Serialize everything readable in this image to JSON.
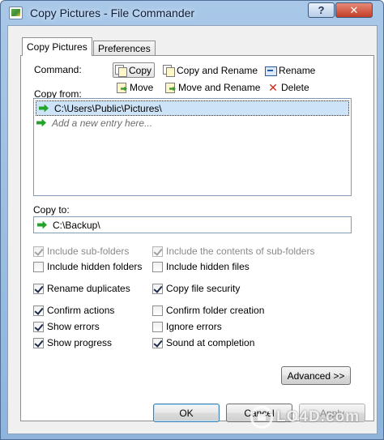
{
  "window": {
    "title": "Copy Pictures - File Commander",
    "help_label": "?",
    "close_label": "✕"
  },
  "tabs": [
    "Copy Pictures",
    "Preferences"
  ],
  "command": {
    "label": "Command:",
    "buttons": [
      "Copy",
      "Copy and Rename",
      "Rename",
      "Move",
      "Move and Rename",
      "Delete"
    ],
    "selected": "Copy"
  },
  "copy_from": {
    "label": "Copy from:",
    "entries": [
      "C:\\Users\\Public\\Pictures\\"
    ],
    "add_placeholder": "Add a new entry here..."
  },
  "copy_to": {
    "label": "Copy to:",
    "value": "C:\\Backup\\"
  },
  "options": {
    "include_subfolders": {
      "label": "Include sub-folders",
      "checked": true,
      "enabled": false
    },
    "include_contents_subfolders": {
      "label": "Include the contents of sub-folders",
      "checked": true,
      "enabled": false
    },
    "include_hidden_folders": {
      "label": "Include hidden folders",
      "checked": false,
      "enabled": true
    },
    "include_hidden_files": {
      "label": "Include hidden files",
      "checked": false,
      "enabled": true
    },
    "rename_duplicates": {
      "label": "Rename duplicates",
      "checked": true,
      "enabled": true
    },
    "copy_file_security": {
      "label": "Copy file security",
      "checked": true,
      "enabled": true
    },
    "confirm_actions": {
      "label": "Confirm actions",
      "checked": true,
      "enabled": true
    },
    "confirm_folder_creation": {
      "label": "Confirm folder creation",
      "checked": false,
      "enabled": true
    },
    "show_errors": {
      "label": "Show errors",
      "checked": true,
      "enabled": true
    },
    "ignore_errors": {
      "label": "Ignore errors",
      "checked": false,
      "enabled": true
    },
    "show_progress": {
      "label": "Show progress",
      "checked": true,
      "enabled": true
    },
    "sound_at_completion": {
      "label": "Sound at completion",
      "checked": true,
      "enabled": true
    }
  },
  "buttons": {
    "advanced": "Advanced >>",
    "ok": "OK",
    "cancel": "Cancel",
    "apply": "Apply"
  },
  "watermark": "LO4D.com"
}
